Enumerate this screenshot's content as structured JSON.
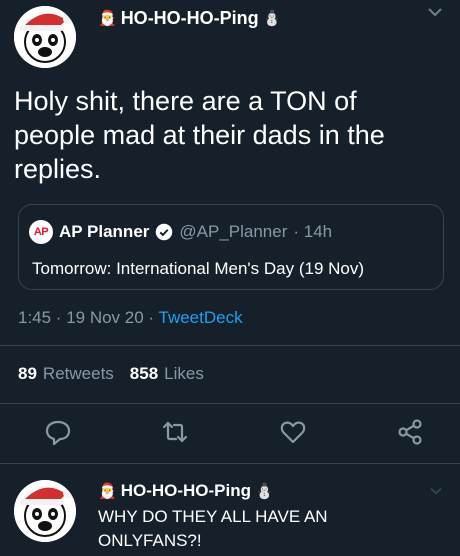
{
  "tweet": {
    "author_name": "HO-HO-HO-Ping",
    "text": "Holy shit, there are a TON of people mad at their dads in the replies.",
    "timestamp": "1:45 · 19 Nov 20 · ",
    "source": "TweetDeck"
  },
  "quoted": {
    "logo_text": "AP",
    "name": "AP Planner",
    "handle": "@AP_Planner",
    "age": "· 14h",
    "text": "Tomorrow: International Men's Day (19 Nov)"
  },
  "stats": {
    "retweets_count": "89",
    "retweets_label": "Retweets",
    "likes_count": "858",
    "likes_label": "Likes"
  },
  "reply": {
    "author_name": "HO-HO-HO-Ping",
    "text": "WHY DO THEY ALL HAVE AN ONLYFANS?!"
  },
  "icons": [
    "santa-emoji-icon",
    "snowman-emoji-icon",
    "chevron-down-icon",
    "verified-badge-icon",
    "reply-icon",
    "retweet-icon",
    "like-icon",
    "share-icon"
  ],
  "colors": {
    "background": "#15202b",
    "accent": "#1da1f2",
    "muted": "#8899a6",
    "border": "#38444d"
  }
}
